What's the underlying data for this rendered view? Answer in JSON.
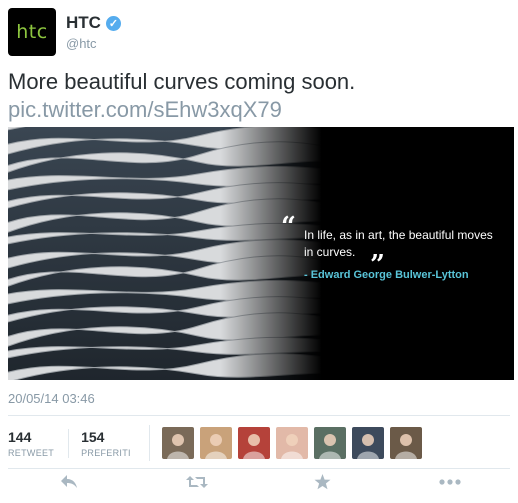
{
  "account": {
    "name": "HTC",
    "handle": "@htc",
    "avatar_text": "htc",
    "verified": true
  },
  "tweet": {
    "text": "More beautiful curves coming soon. ",
    "link": "pic.twitter.com/sEhw3xqX79",
    "timestamp": "20/05/14 03:46"
  },
  "media": {
    "quote_open": "“",
    "quote": "In life, as in art, the beautiful moves in curves.",
    "quote_close": "”",
    "author": "- Edward George Bulwer-Lytton"
  },
  "stats": {
    "retweets_value": "144",
    "retweets_label": "RETWEET",
    "favorites_value": "154",
    "favorites_label": "PREFERITI"
  },
  "favoriters": [
    {
      "icon": "user-avatar",
      "color": "#7a6a58"
    },
    {
      "icon": "user-avatar",
      "color": "#c9a27a"
    },
    {
      "icon": "user-avatar",
      "color": "#b5423a"
    },
    {
      "icon": "user-avatar",
      "color": "#e2b9a8"
    },
    {
      "icon": "user-avatar",
      "color": "#5a6f63"
    },
    {
      "icon": "user-avatar",
      "color": "#3d4a5c"
    },
    {
      "icon": "user-avatar",
      "color": "#6b5a48"
    }
  ],
  "actions": {
    "reply_icon": "reply-icon",
    "retweet_icon": "retweet-icon",
    "favorite_icon": "star-icon",
    "more_icon": "more-icon"
  },
  "colors": {
    "link": "#8899a6",
    "verified": "#55acee",
    "author": "#59c4d8",
    "htc_green": "#8dc63f"
  }
}
